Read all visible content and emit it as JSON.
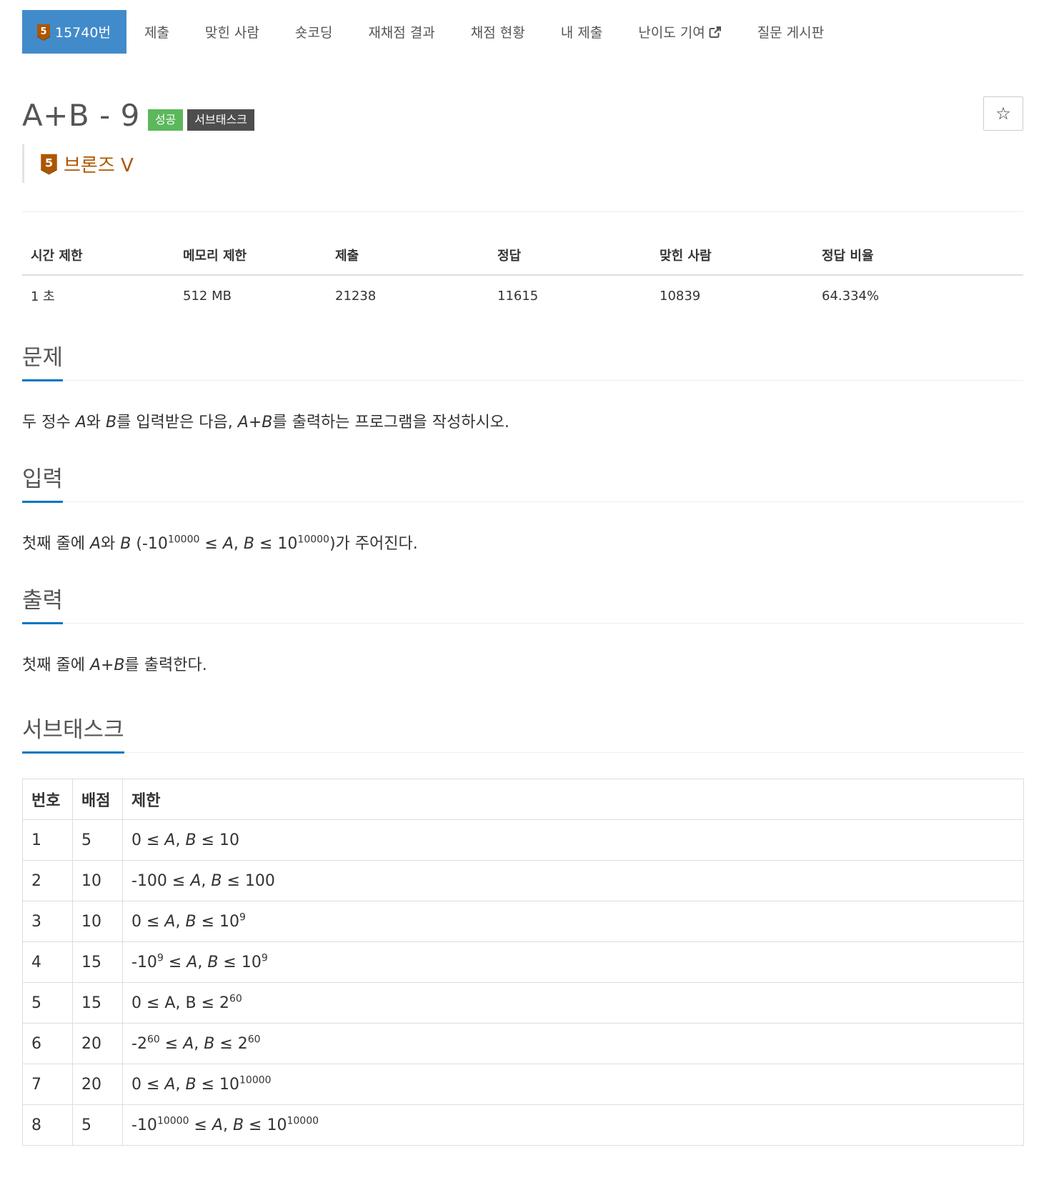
{
  "nav": {
    "items": [
      {
        "label": "15740번",
        "active": true,
        "tier_badge": "5"
      },
      {
        "label": "제출"
      },
      {
        "label": "맞힌 사람"
      },
      {
        "label": "숏코딩"
      },
      {
        "label": "재채점 결과"
      },
      {
        "label": "채점 현황"
      },
      {
        "label": "내 제출"
      },
      {
        "label": "난이도 기여",
        "icon": "external-link-icon"
      },
      {
        "label": "질문 게시판"
      }
    ]
  },
  "problem": {
    "title": "A+B - 9",
    "labels": [
      "성공",
      "서브태스크"
    ],
    "tier_badge": "5",
    "tier": "브론즈 V",
    "tier_color": "#ad5600"
  },
  "info_table": {
    "headers": [
      "시간 제한",
      "메모리 제한",
      "제출",
      "정답",
      "맞힌 사람",
      "정답 비율"
    ],
    "row": [
      "1 초",
      "512 MB",
      "21238",
      "11615",
      "10839",
      "64.334%"
    ]
  },
  "sections": {
    "problem_title": "문제",
    "problem_text": {
      "p1": "두 정수 ",
      "a": "A",
      "p2": "와 ",
      "b": "B",
      "p3": "를 입력받은 다음, ",
      "apb": "A+B",
      "p4": "를 출력하는 프로그램을 작성하시오."
    },
    "input_title": "입력",
    "input_text": {
      "p1": "첫째 줄에 ",
      "a": "A",
      "p2": "와 ",
      "b": "B",
      "p3": " (-10",
      "exp1": "10000",
      "p4": " ≤ ",
      "ab": "A",
      "p5": ", ",
      "bb": "B",
      "p6": " ≤ 10",
      "exp2": "10000",
      "p7": ")가 주어진다."
    },
    "output_title": "출력",
    "output_text": {
      "p1": "첫째 줄에 ",
      "apb": "A+B",
      "p2": "를 출력한다."
    },
    "subtask_title": "서브태스크"
  },
  "subtask_table": {
    "headers": [
      "번호",
      "배점",
      "제한"
    ],
    "rows": [
      {
        "no": "1",
        "score": "5",
        "limit": "0 ≤ A, B ≤ 10"
      },
      {
        "no": "2",
        "score": "10",
        "limit": "-100 ≤ A, B ≤ 100"
      },
      {
        "no": "3",
        "score": "10",
        "limit": "0 ≤ A, B ≤ 10^9"
      },
      {
        "no": "4",
        "score": "15",
        "limit": "-10^9 ≤ A, B ≤ 10^9"
      },
      {
        "no": "5",
        "score": "15",
        "limit": "0 ≤ A, B ≤ 2^60"
      },
      {
        "no": "6",
        "score": "20",
        "limit": "-2^60 ≤ A, B ≤ 2^60"
      },
      {
        "no": "7",
        "score": "20",
        "limit": "0 ≤ A, B ≤ 10^10000"
      },
      {
        "no": "8",
        "score": "5",
        "limit": "-10^10000 ≤ A, B ≤ 10^10000"
      }
    ]
  },
  "colors": {
    "nav_active": "#428bca",
    "label_success": "#5cb85c",
    "label_dark": "#4e4e4e",
    "section_underline": "#0076c0",
    "bronze": "#ad5600"
  }
}
